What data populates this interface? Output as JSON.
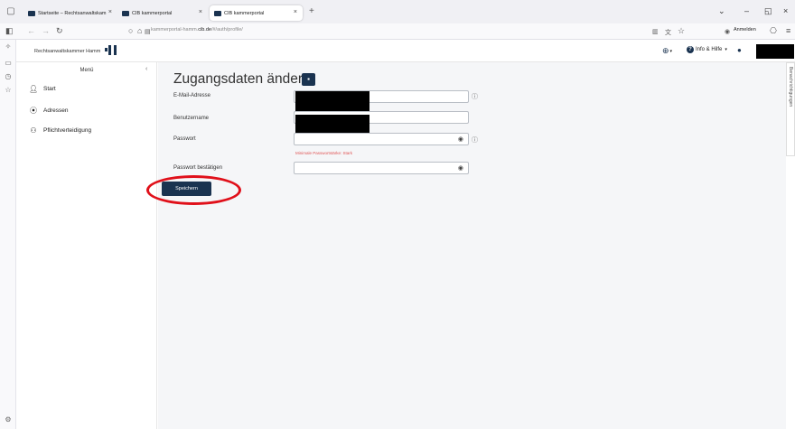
{
  "browser": {
    "tabs": [
      {
        "label": "Startseite – Rechtsanwaltskam",
        "active": false
      },
      {
        "label": "CIB kammerportal",
        "active": false
      },
      {
        "label": "CIB kammerportal",
        "active": true
      }
    ],
    "url_prefix": "kammerportal-hamm.",
    "url_domain": "cib.de",
    "url_suffix": "/#/auth/profile/",
    "signin_label": "Anmelden"
  },
  "header": {
    "brand": "Rechtsanwaltskammer Hamm",
    "help_label": "Info & Hilfe",
    "help_icon_glyph": "?"
  },
  "menu": {
    "title": "Menü",
    "items": [
      {
        "label": "Start",
        "icon": "user-icon"
      },
      {
        "label": "Adressen",
        "icon": "location-pin-icon"
      },
      {
        "label": "Pflichtverteidigung",
        "icon": "people-icon"
      }
    ]
  },
  "form": {
    "title": "Zugangsdaten ändern",
    "email_label": "E-Mail-Adresse",
    "username_label": "Benutzername",
    "password_label": "Passwort",
    "password_hint": "Minimale Passwortstärke: Stark",
    "password_confirm_label": "Passwort bestätigen",
    "save_label": "Speichern"
  },
  "side_tab": {
    "label": "Benachrichtigungen"
  },
  "colors": {
    "brand_navy": "#1a3350",
    "annotation_red": "#e0101a",
    "hint_red": "#e05555"
  }
}
